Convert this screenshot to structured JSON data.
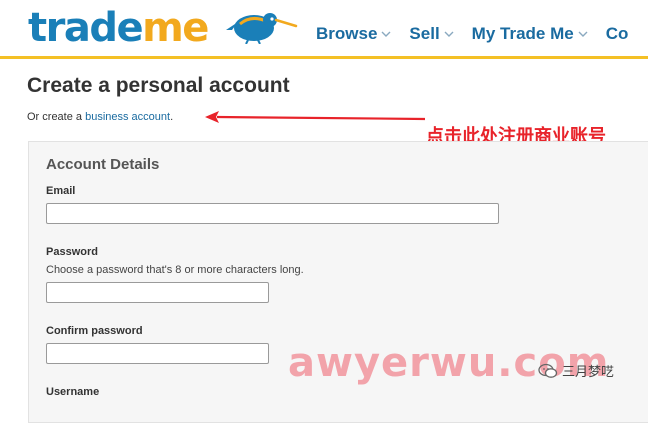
{
  "header": {
    "logo": {
      "part1": "trade",
      "part2": "me"
    },
    "nav": [
      {
        "label": "Browse"
      },
      {
        "label": "Sell"
      },
      {
        "label": "My Trade Me"
      },
      {
        "label": "Co"
      }
    ]
  },
  "main": {
    "title": "Create a personal account",
    "subline": {
      "prefix": "Or create a ",
      "link": "business account",
      "suffix": "."
    },
    "annotation": "点击此处注册商业账号",
    "panel": {
      "title": "Account Details",
      "fields": {
        "email": {
          "label": "Email",
          "value": ""
        },
        "password": {
          "label": "Password",
          "help": "Choose a password that's 8 or more characters long.",
          "value": ""
        },
        "confirm": {
          "label": "Confirm password",
          "value": ""
        },
        "username": {
          "label": "Username"
        }
      }
    }
  },
  "watermark": "awyerwu.com",
  "wechat": {
    "name": "三月梦呓"
  },
  "colors": {
    "brand_blue": "#1a7fb8",
    "brand_orange": "#f2a91e",
    "header_border": "#f4c025",
    "link": "#1a6ba0",
    "annotation_red": "#e8232a"
  }
}
